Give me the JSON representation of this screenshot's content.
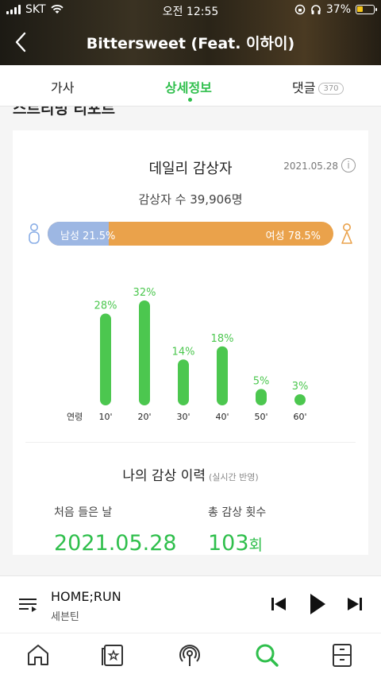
{
  "status_bar": {
    "carrier": "SKT",
    "time": "오전 12:55",
    "battery": "37%",
    "battery_level": 0.37
  },
  "header": {
    "title": "Bittersweet (Feat. 이하이)"
  },
  "tabs": [
    {
      "label": "가사"
    },
    {
      "label": "상세정보",
      "active": true
    },
    {
      "label": "댓글",
      "badge": "370"
    }
  ],
  "section_heading_partial": "스트리밍 리포트",
  "daily": {
    "title": "데일리 감상자",
    "date": "2021.05.28",
    "listener_count": "감상자 수 39,906명",
    "male_label": "남성 21.5%",
    "female_label": "여성 78.5%",
    "male_ratio": 0.215
  },
  "chart_data": {
    "type": "bar",
    "axis_label": "연령",
    "categories": [
      "10'",
      "20'",
      "30'",
      "40'",
      "50'",
      "60'"
    ],
    "values": [
      28,
      32,
      14,
      18,
      5,
      3
    ],
    "value_labels": [
      "28%",
      "32%",
      "14%",
      "18%",
      "5%",
      "3%"
    ],
    "color": "#4cc74f"
  },
  "history": {
    "title": "나의 감상 이력",
    "note": "(실시간 반영)",
    "first_label": "처음 들은 날",
    "first_value": "2021.05.28",
    "count_label": "총 감상 횟수",
    "count_value": "103",
    "count_unit": "회"
  },
  "player": {
    "title": "HOME;RUN",
    "artist": "세븐틴"
  },
  "colors": {
    "accent": "#2fbf4c",
    "male": "#9db7e3",
    "female": "#eaa24b"
  },
  "bottom_nav": [
    "home-icon",
    "chart-icon",
    "podcast-icon",
    "search-icon",
    "storage-icon"
  ]
}
